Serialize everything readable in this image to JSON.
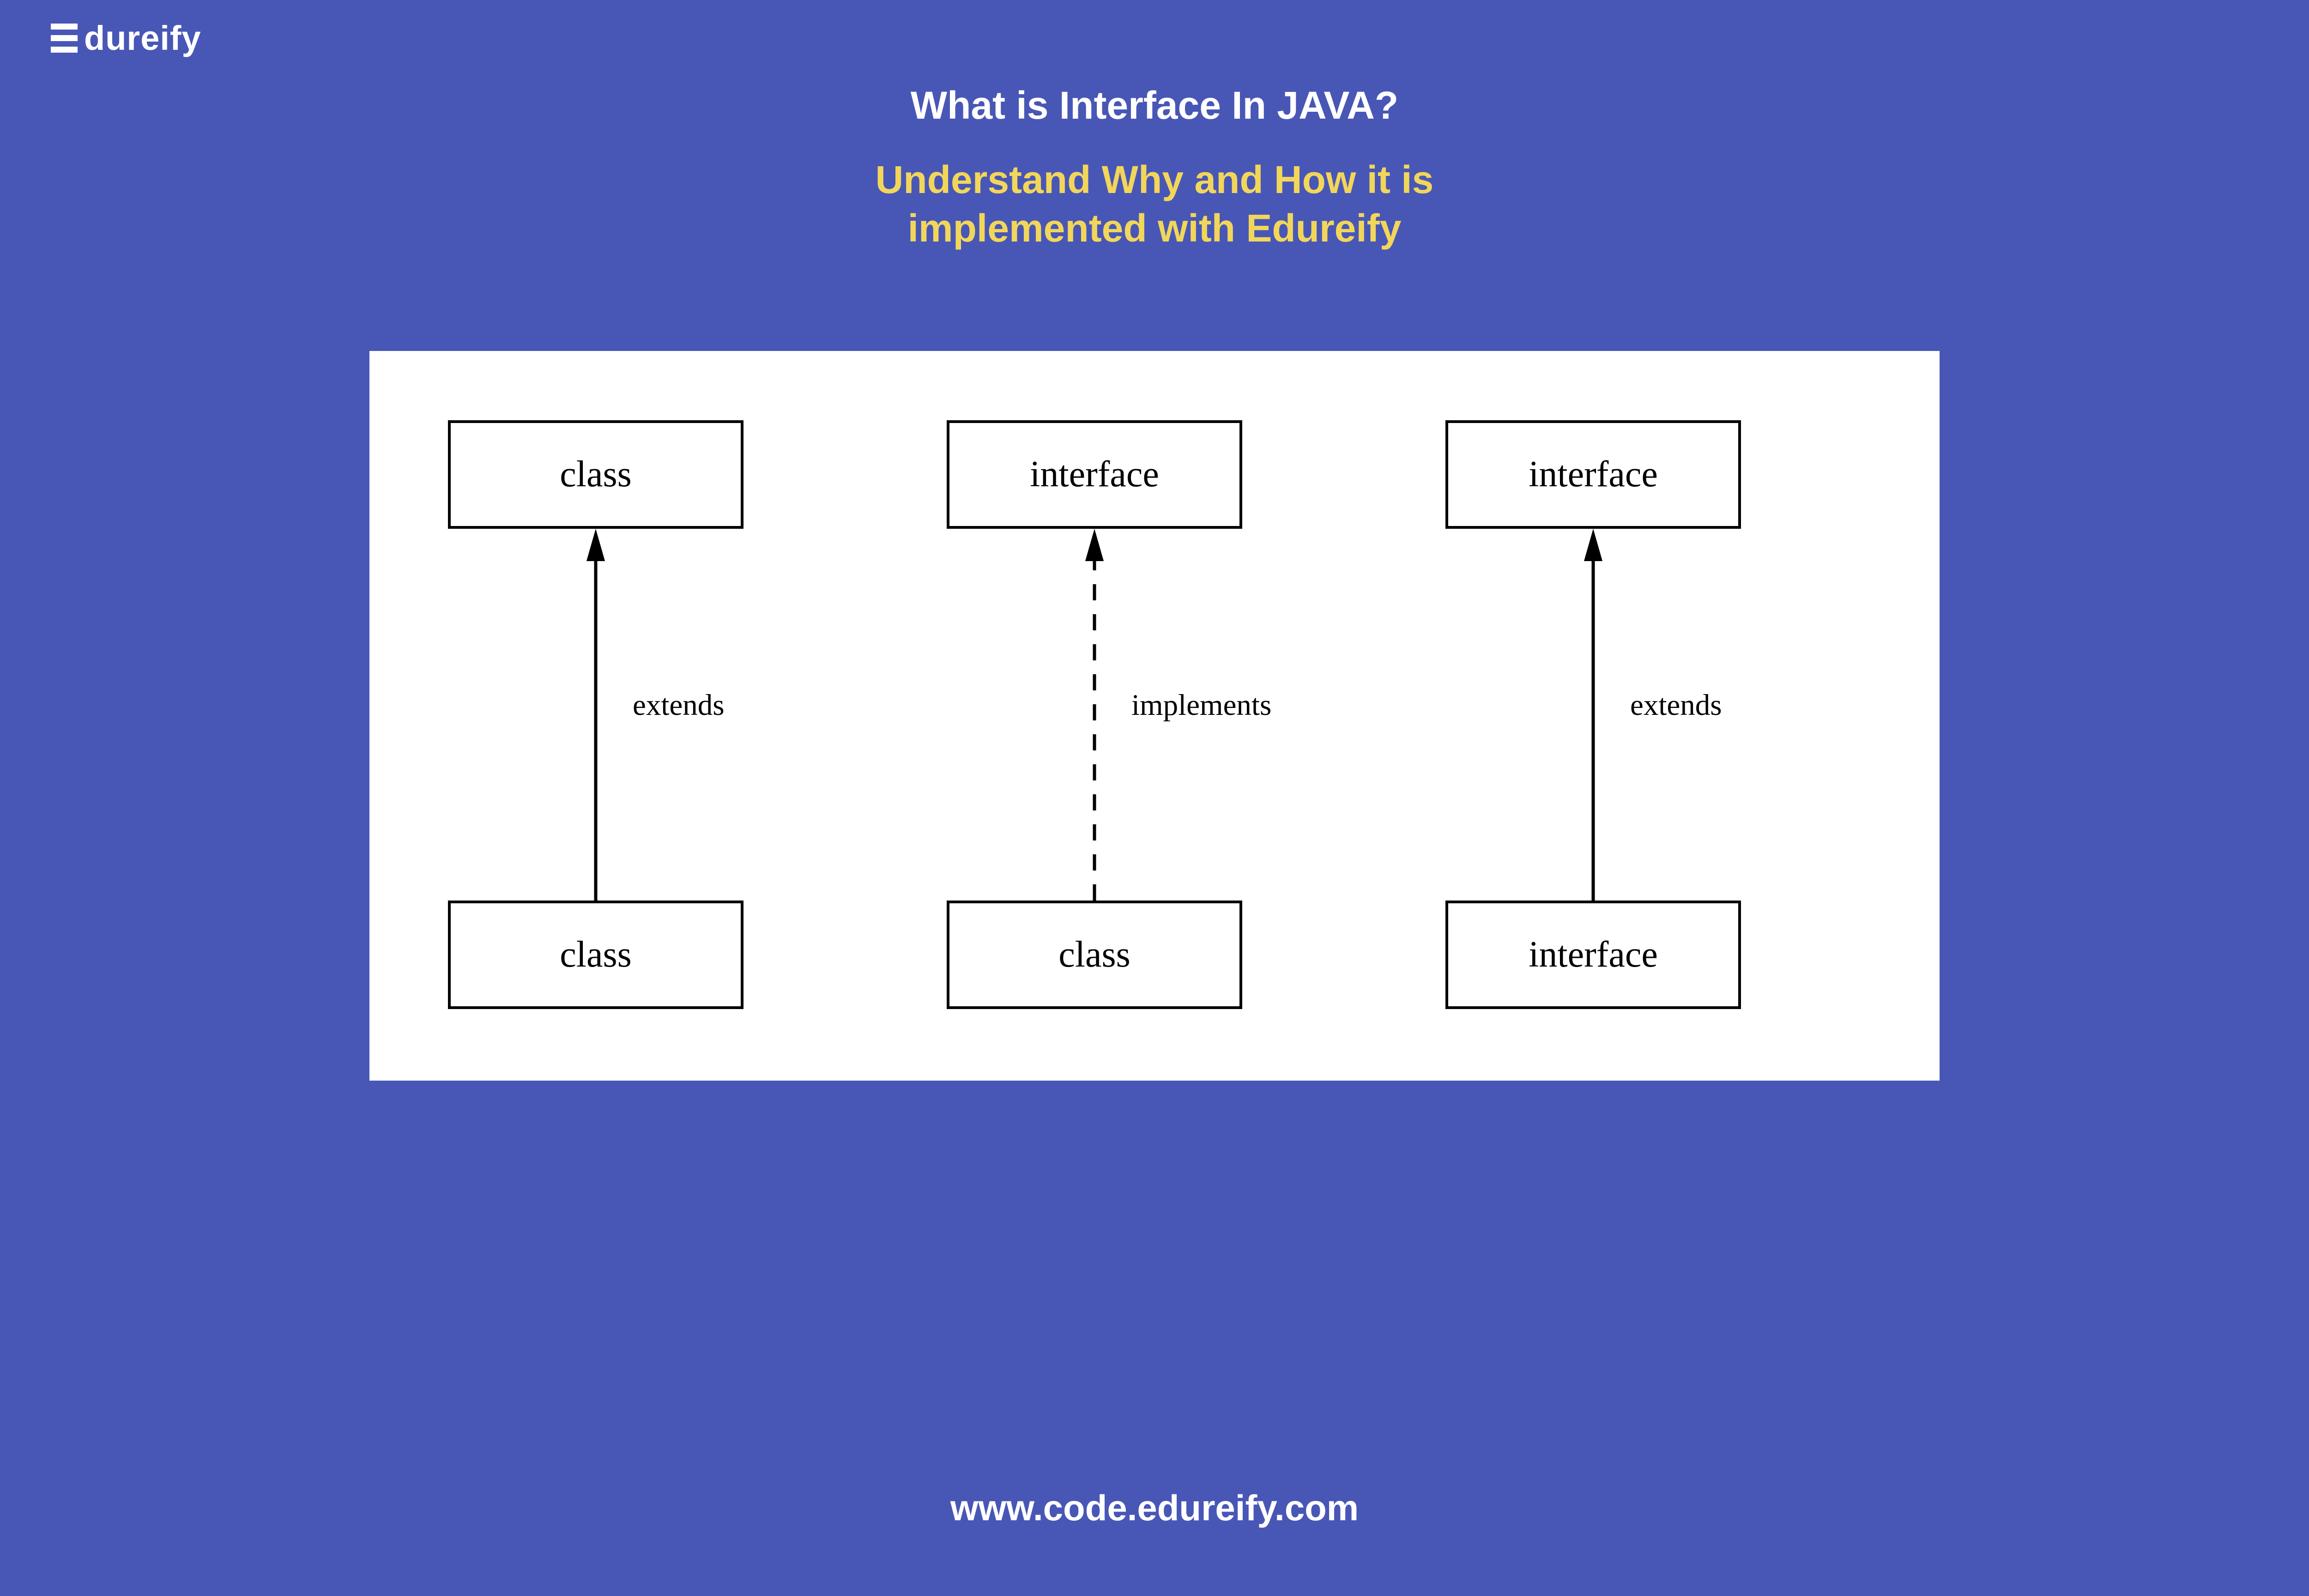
{
  "logo": {
    "text": "dureify"
  },
  "header": {
    "title": "What is Interface In JAVA?",
    "subtitle_line1": "Understand Why and How it is",
    "subtitle_line2": "implemented with Edureify"
  },
  "diagram": {
    "relations": [
      {
        "top": "class",
        "bottom": "class",
        "label": "extends",
        "dashed": false
      },
      {
        "top": "interface",
        "bottom": "class",
        "label": "implements",
        "dashed": true
      },
      {
        "top": "interface",
        "bottom": "interface",
        "label": "extends",
        "dashed": false
      }
    ]
  },
  "footer": {
    "url": "www.code.edureify.com"
  }
}
